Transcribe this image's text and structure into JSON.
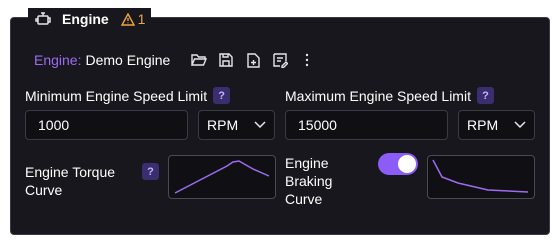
{
  "panel": {
    "title": "Engine",
    "warning_count": "1"
  },
  "engine": {
    "label": "Engine:",
    "value": "Demo Engine"
  },
  "toolbar": {
    "icons": [
      "folder-open-icon",
      "save-icon",
      "new-file-icon",
      "edit-notes-icon",
      "more-vertical-icon"
    ]
  },
  "min_speed": {
    "label": "Minimum Engine Speed Limit",
    "help": "?",
    "value": "1000",
    "unit": "RPM"
  },
  "max_speed": {
    "label": "Maximum Engine Speed Limit",
    "help": "?",
    "value": "15000",
    "unit": "RPM"
  },
  "torque_curve": {
    "label": "Engine Torque Curve",
    "help": "?"
  },
  "braking_curve": {
    "label": "Engine Braking Curve",
    "enabled": true
  },
  "colors": {
    "accent": "#8b5cf6",
    "warning": "#f0a53a",
    "panel_bg": "#17171d"
  }
}
